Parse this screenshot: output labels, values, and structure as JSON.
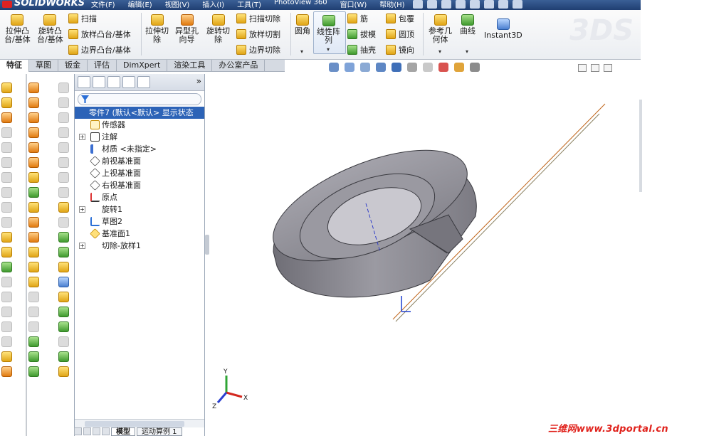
{
  "app": {
    "logo": "SOLIDWORKS"
  },
  "menu": [
    "文件(F)",
    "编辑(E)",
    "视图(V)",
    "插入(I)",
    "工具(T)",
    "PhotoView 360",
    "窗口(W)",
    "帮助(H)"
  ],
  "ribbon": {
    "extrude_boss": [
      "拉伸凸",
      "台/基体"
    ],
    "revolve_boss": [
      "旋转凸",
      "台/基体"
    ],
    "sweep": "扫描",
    "loft_boss": "放样凸台/基体",
    "boundary_boss": "边界凸台/基体",
    "extrude_cut": [
      "拉伸切",
      "除"
    ],
    "hole_wizard": [
      "异型孔",
      "向导"
    ],
    "revolve_cut": [
      "旋转切",
      "除"
    ],
    "sweep_cut": "扫描切除",
    "loft_cut": "放样切割",
    "boundary_cut": "边界切除",
    "fillet": "圆角",
    "linear_pattern": [
      "线性阵",
      "列"
    ],
    "rib": "筋",
    "draft": "拔模",
    "shell": "抽壳",
    "wrap": "包覆",
    "dome": "圆顶",
    "mirror": "镜向",
    "ref_geometry": [
      "参考几",
      "何体"
    ],
    "curves": "曲线",
    "instant3d": "Instant3D"
  },
  "tabs": [
    "特征",
    "草图",
    "钣金",
    "评估",
    "DimXpert",
    "渲染工具",
    "办公室产品"
  ],
  "tree": {
    "root": "零件7  (默认<默认> 显示状态",
    "items": [
      {
        "label": "传感器",
        "expandable": false,
        "icon": "sensor-icon"
      },
      {
        "label": "注解",
        "expandable": true,
        "icon": "annotation-icon"
      },
      {
        "label": "材质 <未指定>",
        "expandable": false,
        "icon": "material-icon"
      },
      {
        "label": "前视基准面",
        "expandable": false,
        "icon": "plane-icon"
      },
      {
        "label": "上视基准面",
        "expandable": false,
        "icon": "plane-icon"
      },
      {
        "label": "右视基准面",
        "expandable": false,
        "icon": "plane-icon"
      },
      {
        "label": "原点",
        "expandable": false,
        "icon": "origin-icon"
      },
      {
        "label": "旋转1",
        "expandable": true,
        "icon": "revolve-icon"
      },
      {
        "label": "草图2",
        "expandable": false,
        "icon": "sketch-icon"
      },
      {
        "label": "基准面1",
        "expandable": false,
        "icon": "plane-icon"
      },
      {
        "label": "切除-放样1",
        "expandable": true,
        "icon": "loft-cut-icon"
      }
    ]
  },
  "bottom_tabs": [
    "模型",
    "运动算例 1"
  ],
  "triad": {
    "x": "X",
    "y": "Y",
    "z": "Z"
  },
  "watermark": "三维网www.3dportal.cn",
  "colors": {
    "accent": "#2c63b7",
    "watermark": "#e0211b",
    "part": "#8d8c94"
  }
}
